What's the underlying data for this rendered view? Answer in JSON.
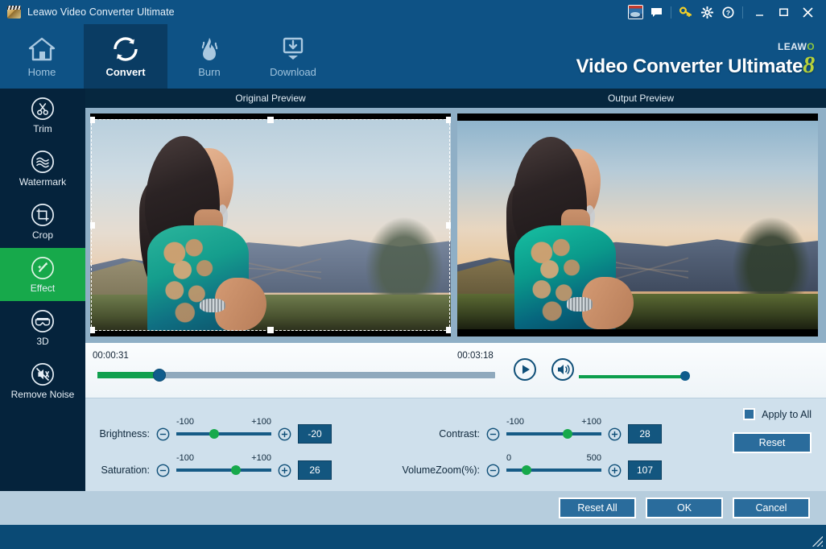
{
  "window": {
    "title": "Leawo Video Converter Ultimate",
    "app_icon": "clapperboard-icon",
    "controls": {
      "minimize": "–",
      "maximize": "□",
      "close": "✕"
    },
    "tray_icons": [
      {
        "name": "supports-thumbnail-icon",
        "label": "Supports"
      },
      {
        "name": "feedback-chat-icon",
        "label": "Feedback"
      },
      {
        "name": "register-key-icon",
        "label": "Register"
      },
      {
        "name": "settings-gear-icon",
        "label": "Settings"
      },
      {
        "name": "help-question-icon",
        "label": "Help"
      }
    ]
  },
  "nav": {
    "tabs": [
      {
        "label": "Home",
        "icon": "home-icon",
        "active": false
      },
      {
        "label": "Convert",
        "icon": "convert-refresh-icon",
        "active": true
      },
      {
        "label": "Burn",
        "icon": "flame-icon",
        "active": false
      },
      {
        "label": "Download",
        "icon": "download-monitor-icon",
        "active": false
      }
    ],
    "brand_top": "LEAW",
    "brand_top_o": "O",
    "brand_main": "Video Converter Ultimate",
    "brand_version": "8"
  },
  "sidebar": {
    "items": [
      {
        "label": "Trim",
        "icon": "scissors-icon",
        "active": false
      },
      {
        "label": "Watermark",
        "icon": "waves-icon",
        "active": false
      },
      {
        "label": "Crop",
        "icon": "crop-icon",
        "active": false
      },
      {
        "label": "Effect",
        "icon": "magic-wand-icon",
        "active": true
      },
      {
        "label": "3D",
        "icon": "glasses-3d-icon",
        "active": false
      },
      {
        "label": "Remove Noise",
        "icon": "noise-off-icon",
        "active": false
      }
    ]
  },
  "preview": {
    "original_label": "Original Preview",
    "output_label": "Output Preview"
  },
  "player": {
    "current_time": "00:00:31",
    "total_time": "00:03:18",
    "play_icon": "play-circle-icon",
    "volume_icon": "speaker-circle-icon",
    "seek_percent": 15.5,
    "volume_percent": 100
  },
  "adjust": {
    "brightness": {
      "label": "Brightness:",
      "min": "-100",
      "max": "+100",
      "value": "-20",
      "percent": 40
    },
    "saturation": {
      "label": "Saturation:",
      "min": "-100",
      "max": "+100",
      "value": "26",
      "percent": 63
    },
    "contrast": {
      "label": "Contrast:",
      "min": "-100",
      "max": "+100",
      "value": "28",
      "percent": 64
    },
    "volumezoom": {
      "label": "VolumeZoom(%):",
      "min": "0",
      "max": "500",
      "value": "107",
      "percent": 21
    },
    "decrease_icon": "minus-circle-icon",
    "increase_icon": "plus-circle-icon",
    "apply_to_all_label": "Apply to All",
    "apply_to_all_checked": true,
    "reset_label": "Reset"
  },
  "footer": {
    "reset_all_label": "Reset All",
    "ok_label": "OK",
    "cancel_label": "Cancel"
  },
  "colors": {
    "accent_green": "#17a94b",
    "title_blue": "#0e5285",
    "sidebar_dark": "#05233c",
    "panel_blue": "#cfe0ec",
    "button_blue": "#2a6c9c",
    "brand_lime": "#b7d23a"
  }
}
